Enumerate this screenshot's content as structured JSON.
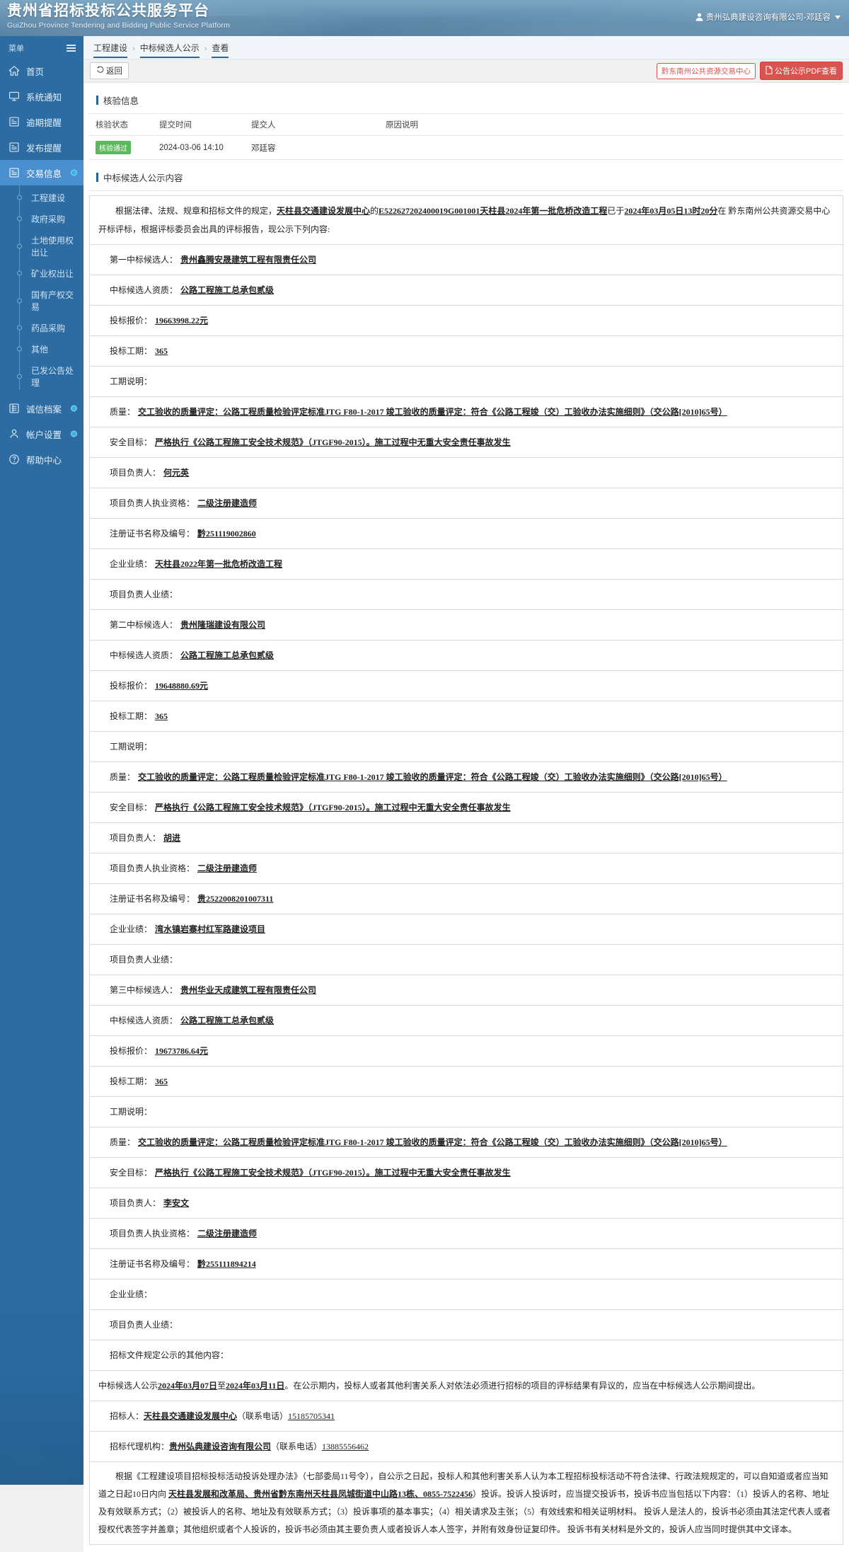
{
  "header": {
    "title_cn": "贵州省招标投标公共服务平台",
    "title_en": "GuiZhou Province Tendering and Bidding Public Service Platform",
    "user": "贵州弘典建设咨询有限公司-邓廷容"
  },
  "sidebar": {
    "menu_label": "菜单",
    "items": [
      {
        "label": "首页",
        "icon": "home-icon",
        "active": false,
        "badge": false
      },
      {
        "label": "系统通知",
        "icon": "monitor-icon",
        "active": false,
        "badge": false
      },
      {
        "label": "逾期提醒",
        "icon": "document-icon",
        "active": false,
        "badge": false
      },
      {
        "label": "发布提醒",
        "icon": "document-icon",
        "active": false,
        "badge": false
      },
      {
        "label": "交易信息",
        "icon": "document-icon",
        "active": true,
        "badge": true
      }
    ],
    "sub_items": [
      "工程建设",
      "政府采购",
      "土地使用权出让",
      "矿业权出让",
      "国有产权交易",
      "药品采购",
      "其他",
      "已发公告处理"
    ],
    "bottom_items": [
      {
        "label": "诚信档案",
        "icon": "archive-icon",
        "badge": true
      },
      {
        "label": "帐户设置",
        "icon": "user-icon",
        "badge": true
      },
      {
        "label": "帮助中心",
        "icon": "question-icon",
        "badge": false
      }
    ]
  },
  "breadcrumb": [
    "工程建设",
    "中标候选人公示",
    "查看"
  ],
  "toolbar": {
    "back_label": "返回",
    "center_label": "黔东南州公共资源交易中心",
    "pdf_label": "公告公示PDF查看"
  },
  "verify_section": {
    "title": "核验信息",
    "columns": [
      "核验状态",
      "提交时间",
      "提交人",
      "原因说明"
    ],
    "rows": [
      {
        "status": "核验通过",
        "time": "2024-03-06 14:10",
        "person": "邓廷容",
        "reason": ""
      }
    ]
  },
  "notice_section": {
    "title": "中标候选人公示内容",
    "intro": {
      "p1": "根据法律、法规、规章和招标文件的规定，",
      "agency": "天柱县交通建设发展中心",
      "p2": "的",
      "project": "E522627202400019G001001天柱县2024年第一批危桥改造工程",
      "p3": "已于",
      "datetime": "2024年03月05日13时20分",
      "p4": "在 黔东南州公共资源交易中心开标评标，根据评标委员会出具的评标报告，现公示下列内容:"
    },
    "candidates": [
      {
        "rank_label": "第一中标候选人：",
        "name": "贵州鑫腾安晟建筑工程有限责任公司",
        "qual_label": "中标候选人资质：",
        "qual": "公路工程施工总承包贰级",
        "price_label": "投标报价：",
        "price": "19663998.22元",
        "duration_label": "投标工期：",
        "duration": "365",
        "duration_note_label": "工期说明：",
        "duration_note": "",
        "quality_label": "质量：",
        "quality": "交工验收的质量评定：公路工程质量检验评定标准JTG F80-1-2017 竣工验收的质量评定：符合《公路工程竣（交）工验收办法实施细则》（交公路[2010]65号）",
        "safety_label": "安全目标：",
        "safety": "严格执行《公路工程施工安全技术规范》（JTGF90-2015）。施工过程中无重大安全责任事故发生",
        "manager_label": "项目负责人：",
        "manager": "何元英",
        "cert_label": "项目负责人执业资格：",
        "cert": "二级注册建造师",
        "cert_no_label": "注册证书名称及编号：",
        "cert_no": "黔251119002860",
        "company_perf_label": "企业业绩：",
        "company_perf": "天柱县2022年第一批危桥改造工程",
        "manager_perf_label": "项目负责人业绩：",
        "manager_perf": ""
      },
      {
        "rank_label": "第二中标候选人：",
        "name": "贵州隆瑞建设有限公司",
        "qual_label": "中标候选人资质：",
        "qual": "公路工程施工总承包贰级",
        "price_label": "投标报价：",
        "price": "19648880.69元",
        "duration_label": "投标工期：",
        "duration": "365",
        "duration_note_label": "工期说明：",
        "duration_note": "",
        "quality_label": "质量：",
        "quality": "交工验收的质量评定：公路工程质量检验评定标准JTG F80-1-2017 竣工验收的质量评定：符合《公路工程竣（交）工验收办法实施细则》（交公路[2010]65号）",
        "safety_label": "安全目标：",
        "safety": "严格执行《公路工程施工安全技术规范》（JTGF90-2015）。施工过程中无重大安全责任事故发生",
        "manager_label": "项目负责人：",
        "manager": "胡进",
        "cert_label": "项目负责人执业资格：",
        "cert": "二级注册建造师",
        "cert_no_label": "注册证书名称及编号：",
        "cert_no": "贵2522008201007311",
        "company_perf_label": "企业业绩：",
        "company_perf": "湾水镇岩寨村红军路建设项目",
        "manager_perf_label": "项目负责人业绩：",
        "manager_perf": ""
      },
      {
        "rank_label": "第三中标候选人：",
        "name": "贵州华业天成建筑工程有限责任公司",
        "qual_label": "中标候选人资质：",
        "qual": "公路工程施工总承包贰级",
        "price_label": "投标报价：",
        "price": "19673786.64元",
        "duration_label": "投标工期：",
        "duration": "365",
        "duration_note_label": "工期说明：",
        "duration_note": "",
        "quality_label": "质量：",
        "quality": "交工验收的质量评定：公路工程质量检验评定标准JTG F80-1-2017 竣工验收的质量评定：符合《公路工程竣（交）工验收办法实施细则》（交公路[2010]65号）",
        "safety_label": "安全目标：",
        "safety": "严格执行《公路工程施工安全技术规范》（JTGF90-2015）。施工过程中无重大安全责任事故发生",
        "manager_label": "项目负责人：",
        "manager": "李安文",
        "cert_label": "项目负责人执业资格：",
        "cert": "二级注册建造师",
        "cert_no_label": "注册证书名称及编号：",
        "cert_no": "黔255111894214",
        "company_perf_label": "企业业绩：",
        "company_perf": "",
        "manager_perf_label": "项目负责人业绩：",
        "manager_perf": ""
      }
    ],
    "other_label": "招标文件规定公示的其他内容：",
    "publicity": {
      "prefix": "中标候选人公示",
      "start": "2024年03月07日",
      "mid": "至",
      "end": "2024年03月11日",
      "suffix": "。在公示期内，投标人或者其他利害关系人对依法必须进行招标的项目的评标结果有异议的，应当在中标候选人公示期间提出。"
    },
    "tenderer_label": "招标人：",
    "tenderer": "天柱县交通建设发展中心",
    "tenderer_phone_label": "（联系电话）",
    "tenderer_phone": "15185705341",
    "agent_label": "招标代理机构：",
    "agent": "贵州弘典建设咨询有限公司",
    "agent_phone_label": "（联系电话）",
    "agent_phone": "13885556462",
    "complaint": {
      "t1": "根据《工程建设项目招标投标活动投诉处理办法》（七部委局11号令），自公示之日起，投标人和其他利害关系人认为本工程招标投标活动不符合法律、行政法规规定的，可以自知道或者应当知道之日起10日内向 ",
      "org1": "天柱县发展和改革局、",
      "org2": "贵州省黔东南州天柱县凤城街道中山路13栋、",
      "phone": "0855-7522456",
      "t2": "）投诉。投诉人投诉时，应当提交投诉书，投诉书应当包括以下内容：（1）投诉人的名称、地址及有效联系方式；（2）被投诉人的名称、地址及有效联系方式；（3）投诉事项的基本事实；（4）相关请求及主张；（5）有效线索和相关证明材料。 投诉人是法人的，投诉书必须由其法定代表人或者授权代表签字并盖章；其他组织或者个人投诉的，投诉书必须由其主要负责人或者投诉人本人签字，并附有效身份证复印件。 投诉书有关材料是外文的，投诉人应当同时提供其中文译本。"
    }
  }
}
